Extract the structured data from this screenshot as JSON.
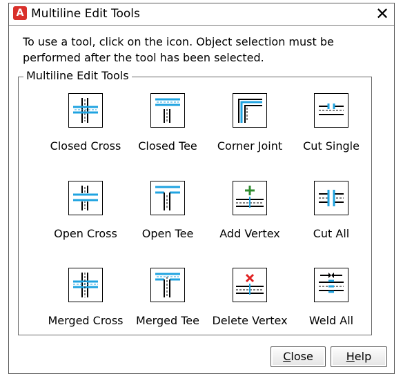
{
  "window": {
    "title": "Multiline Edit Tools",
    "app_icon_letter": "A",
    "close_glyph": "✕"
  },
  "instructions": "To use a tool, click on the icon. Object selection must be performed after the tool has been selected.",
  "group_label": "Multiline Edit Tools",
  "tools": [
    {
      "label": "Closed Cross",
      "icon": "closed-cross-icon"
    },
    {
      "label": "Closed Tee",
      "icon": "closed-tee-icon"
    },
    {
      "label": "Corner Joint",
      "icon": "corner-joint-icon"
    },
    {
      "label": "Cut Single",
      "icon": "cut-single-icon"
    },
    {
      "label": "Open Cross",
      "icon": "open-cross-icon"
    },
    {
      "label": "Open Tee",
      "icon": "open-tee-icon"
    },
    {
      "label": "Add Vertex",
      "icon": "add-vertex-icon"
    },
    {
      "label": "Cut All",
      "icon": "cut-all-icon"
    },
    {
      "label": "Merged Cross",
      "icon": "merged-cross-icon"
    },
    {
      "label": "Merged Tee",
      "icon": "merged-tee-icon"
    },
    {
      "label": "Delete Vertex",
      "icon": "delete-vertex-icon"
    },
    {
      "label": "Weld All",
      "icon": "weld-all-icon"
    }
  ],
  "buttons": {
    "close": {
      "label": "Close",
      "mnemonic": "C",
      "rest": "lose"
    },
    "help": {
      "label": "Help",
      "mnemonic": "H",
      "rest": "elp"
    }
  },
  "colors": {
    "accent_blue": "#1fa3e0",
    "add_green": "#2e8b2e",
    "delete_red": "#e02020",
    "app_icon_red": "#d9302b"
  }
}
